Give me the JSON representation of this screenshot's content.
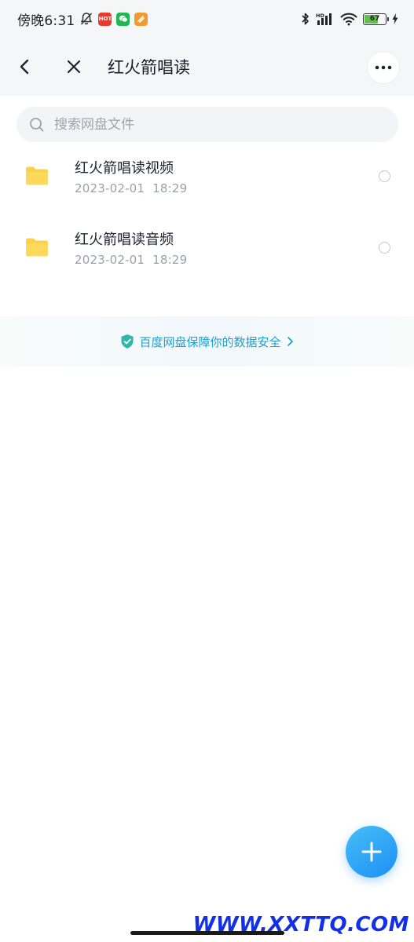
{
  "status_bar": {
    "time": "傍晚6:31",
    "app_badges": [
      {
        "name": "video-app-icon",
        "text": "HOT",
        "color": "#e83b2f"
      },
      {
        "name": "wechat-icon",
        "text": "",
        "color": "#1fb752"
      },
      {
        "name": "orange-app-icon",
        "text": "",
        "color": "#f29a2e"
      }
    ],
    "battery_level": "67",
    "battery_fraction": 0.67
  },
  "header": {
    "title": "红火箭唱读"
  },
  "search": {
    "placeholder": "搜索网盘文件"
  },
  "files": [
    {
      "name": "红火箭唱读视频",
      "date": "2023-02-01  18:29",
      "icon": "folder-icon"
    },
    {
      "name": "红火箭唱读音频",
      "date": "2023-02-01  18:29",
      "icon": "folder-icon"
    }
  ],
  "security_banner": {
    "text": "百度网盘保障你的数据安全"
  },
  "watermark": "WWW.XXTTQ.COM",
  "colors": {
    "accent": "#1e8ff5",
    "folder": "#fbd04a",
    "banner_text": "#1f9fcf"
  }
}
